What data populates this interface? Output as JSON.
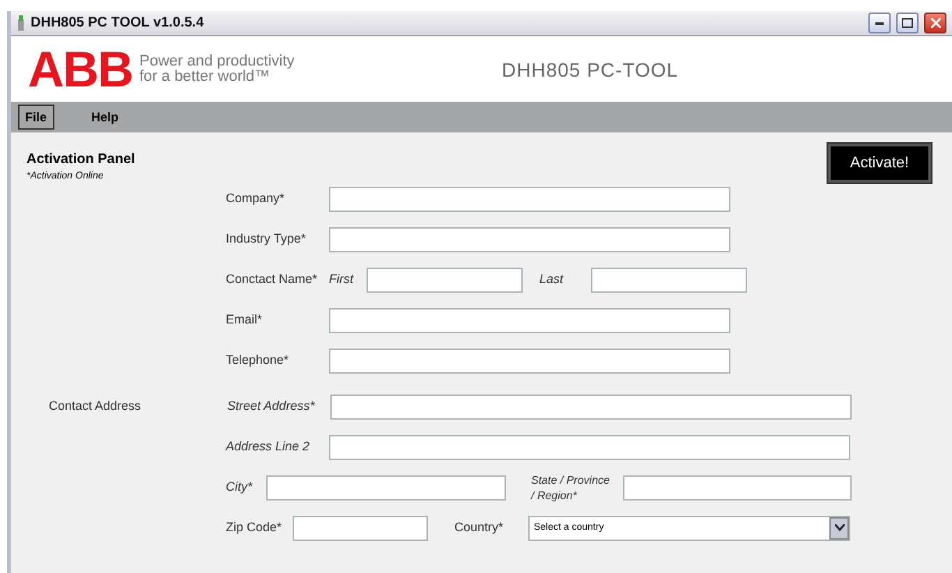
{
  "window": {
    "title": "DHH805 PC TOOL v1.0.5.4"
  },
  "header": {
    "logo": "ABB",
    "tagline": [
      "Power and productivity",
      "for a better world™"
    ],
    "title": "DHH805 PC-TOOL"
  },
  "menu": [
    {
      "label": "File",
      "selected": true
    },
    {
      "label": "Help",
      "selected": false
    }
  ],
  "panel": {
    "title": "Activation Panel",
    "subtitle": "*Activation Online",
    "button": "Activate!"
  },
  "contact": [
    {
      "label": "Company*",
      "kind": "single"
    },
    {
      "label": "Industry Type*",
      "kind": "single"
    },
    {
      "label": "Conctact Name*",
      "kind": "name",
      "first": "First",
      "last": "Last"
    },
    {
      "label": "Email*",
      "kind": "single"
    },
    {
      "label": "Telephone*",
      "kind": "single"
    }
  ],
  "address": {
    "label": "Contact Address",
    "street": "Street Address*",
    "line2": "Address Line 2",
    "city": "City*",
    "state": [
      "State / Province",
      "/ Region*"
    ],
    "zip": "Zip Code*",
    "country": "Country*",
    "country_value": "Select a country"
  }
}
